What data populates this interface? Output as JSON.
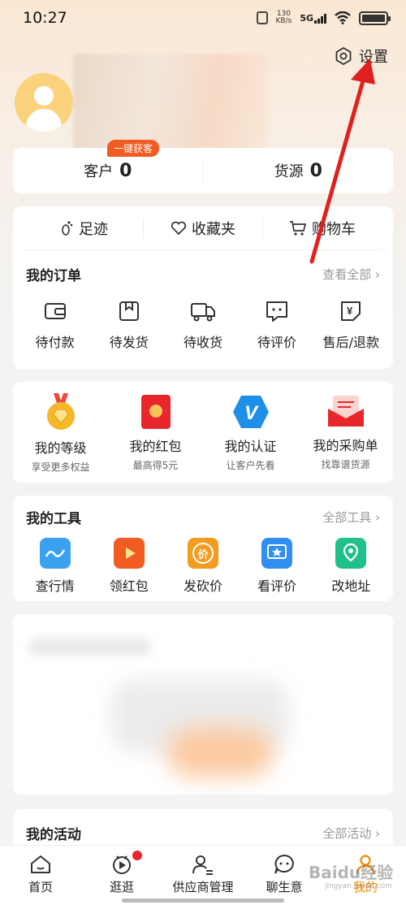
{
  "status": {
    "time": "10:27",
    "net_speed_value": "130",
    "net_speed_unit": "KB/s",
    "network": "5G"
  },
  "header": {
    "settings_label": "设置"
  },
  "stats": {
    "badge": "一键获客",
    "customers_label": "客户",
    "customers_value": "0",
    "sources_label": "货源",
    "sources_value": "0"
  },
  "quick": [
    {
      "label": "足迹",
      "icon": "footprint-icon"
    },
    {
      "label": "收藏夹",
      "icon": "heart-icon"
    },
    {
      "label": "购物车",
      "icon": "cart-icon"
    }
  ],
  "orders": {
    "title": "我的订单",
    "more": "查看全部",
    "items": [
      {
        "label": "待付款",
        "icon": "wallet-icon"
      },
      {
        "label": "待发货",
        "icon": "box-icon"
      },
      {
        "label": "待收货",
        "icon": "truck-icon"
      },
      {
        "label": "待评价",
        "icon": "comment-icon"
      },
      {
        "label": "售后/退款",
        "icon": "refund-icon"
      }
    ]
  },
  "perks": [
    {
      "name": "我的等级",
      "sub": "享受更多权益",
      "icon": "medal-icon"
    },
    {
      "name": "我的红包",
      "sub": "最高得5元",
      "icon": "red-envelope-icon",
      "icon_text": "领"
    },
    {
      "name": "我的认证",
      "sub": "让客户先看",
      "icon": "verified-icon",
      "icon_text": "V"
    },
    {
      "name": "我的采购单",
      "sub": "找靠谱货源",
      "icon": "purchase-order-icon"
    }
  ],
  "tools": {
    "title": "我的工具",
    "more": "全部工具",
    "items": [
      {
        "label": "查行情",
        "icon": "trend-icon",
        "color": "#3aa0f0"
      },
      {
        "label": "领红包",
        "icon": "video-hongbao-icon",
        "color": "#f25b21"
      },
      {
        "label": "发砍价",
        "icon": "bargain-icon",
        "color": "#f39c1e",
        "icon_text": "价"
      },
      {
        "label": "看评价",
        "icon": "star-review-icon",
        "color": "#2f8ff0"
      },
      {
        "label": "改地址",
        "icon": "location-icon",
        "color": "#1fc08a"
      }
    ]
  },
  "activity": {
    "title": "我的活动",
    "more": "全部活动"
  },
  "tabbar": [
    {
      "label": "首页",
      "icon": "home-icon"
    },
    {
      "label": "逛逛",
      "icon": "explore-icon"
    },
    {
      "label": "供应商管理",
      "icon": "supplier-icon"
    },
    {
      "label": "聊生意",
      "icon": "chat-icon"
    },
    {
      "label": "我的",
      "icon": "profile-icon"
    }
  ],
  "watermark": {
    "text": "Baidu经验",
    "sub": "jingyan.baidu.com"
  },
  "colors": {
    "accent": "#f08a00",
    "badge": "#f25b21",
    "arrow": "#e0201c"
  }
}
